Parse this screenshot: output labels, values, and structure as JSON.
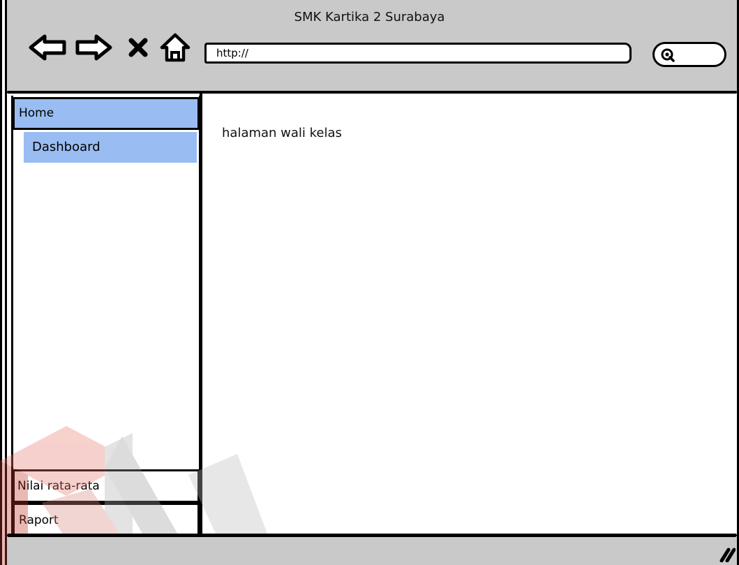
{
  "window": {
    "title": "SMK Kartika 2 Surabaya"
  },
  "toolbar": {
    "back_icon": "back-arrow-icon",
    "forward_icon": "forward-arrow-icon",
    "stop_icon": "close-icon",
    "home_icon": "home-icon",
    "search_icon": "search-icon"
  },
  "address_bar": {
    "value": "http://"
  },
  "sidebar": {
    "items": [
      {
        "label": "Home",
        "selected": true
      },
      {
        "label": "Dashboard",
        "selected": true
      },
      {
        "label": "Nilai rata-rata",
        "selected": false
      },
      {
        "label": "Raport",
        "selected": false
      }
    ]
  },
  "main": {
    "text": "halaman wali kelas"
  },
  "colors": {
    "chrome": "#c9c9c9",
    "selected": "#99bdf2",
    "border": "#000000",
    "watermark": "#c0392b"
  }
}
